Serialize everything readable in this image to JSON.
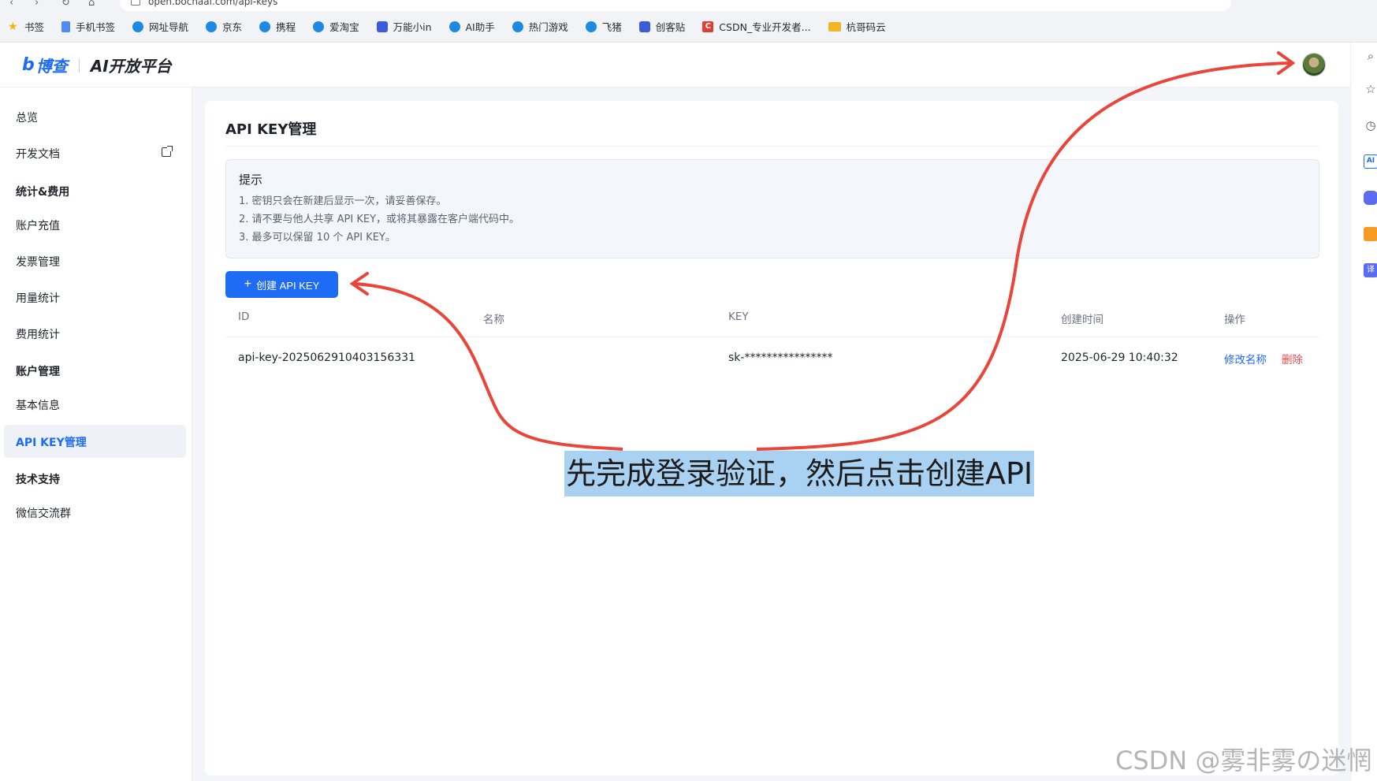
{
  "browser": {
    "url": "open.bochaai.com/api-keys",
    "bookmarks": [
      {
        "icon": "star-icon",
        "label": "书签"
      },
      {
        "icon": "phone-icon",
        "label": "手机书签"
      },
      {
        "icon": "e-icon",
        "label": "网址导航"
      },
      {
        "icon": "e-icon",
        "label": "京东"
      },
      {
        "icon": "e-icon",
        "label": "携程"
      },
      {
        "icon": "e-icon",
        "label": "爱淘宝"
      },
      {
        "icon": "box-icon",
        "label": "万能小in"
      },
      {
        "icon": "e-icon",
        "label": "AI助手"
      },
      {
        "icon": "e-icon",
        "label": "热门游戏"
      },
      {
        "icon": "e-icon",
        "label": "飞猪"
      },
      {
        "icon": "box-icon",
        "label": "创客贴"
      },
      {
        "icon": "csdn-icon",
        "label": "CSDN_专业开发者..."
      },
      {
        "icon": "folder-icon",
        "label": "杭哥码云"
      }
    ]
  },
  "header": {
    "logo_mark": "b",
    "logo_brand": "博查",
    "logo_title": "AI开放平台"
  },
  "sidebar": {
    "overview": "总览",
    "docs": "开发文档",
    "group_billing": "统计&费用",
    "recharge": "账户充值",
    "invoice": "发票管理",
    "usage": "用量统计",
    "cost": "费用统计",
    "group_account": "账户管理",
    "basic_info": "基本信息",
    "api_key_mgmt": "API KEY管理",
    "group_support": "技术支持",
    "wechat_group": "微信交流群"
  },
  "main": {
    "title": "API KEY管理",
    "tip": {
      "title": "提示",
      "lines": [
        "1. 密钥只会在新建后显示一次，请妥善保存。",
        "2. 请不要与他人共享 API KEY，或将其暴露在客户端代码中。",
        "3. 最多可以保留 10 个 API KEY。"
      ]
    },
    "create_button": "创建 API KEY",
    "table": {
      "headers": {
        "id": "ID",
        "name": "名称",
        "key": "KEY",
        "created": "创建时间",
        "actions": "操作"
      },
      "rows": [
        {
          "id": "api-key-20250629104031563​31",
          "name": "",
          "key": "sk-****************",
          "created": "2025-06-29 10:40:32",
          "edit": "修改名称",
          "delete": "删除"
        }
      ]
    }
  },
  "annotation": {
    "text": "先完成登录验证，然后点击创建API",
    "arrow_color": "#e8463a",
    "highlight_color": "#a9d1f2"
  },
  "watermark": "CSDN @雾非雾の迷惘",
  "colors": {
    "accent": "#1e6bf5",
    "danger": "#e5484d"
  }
}
